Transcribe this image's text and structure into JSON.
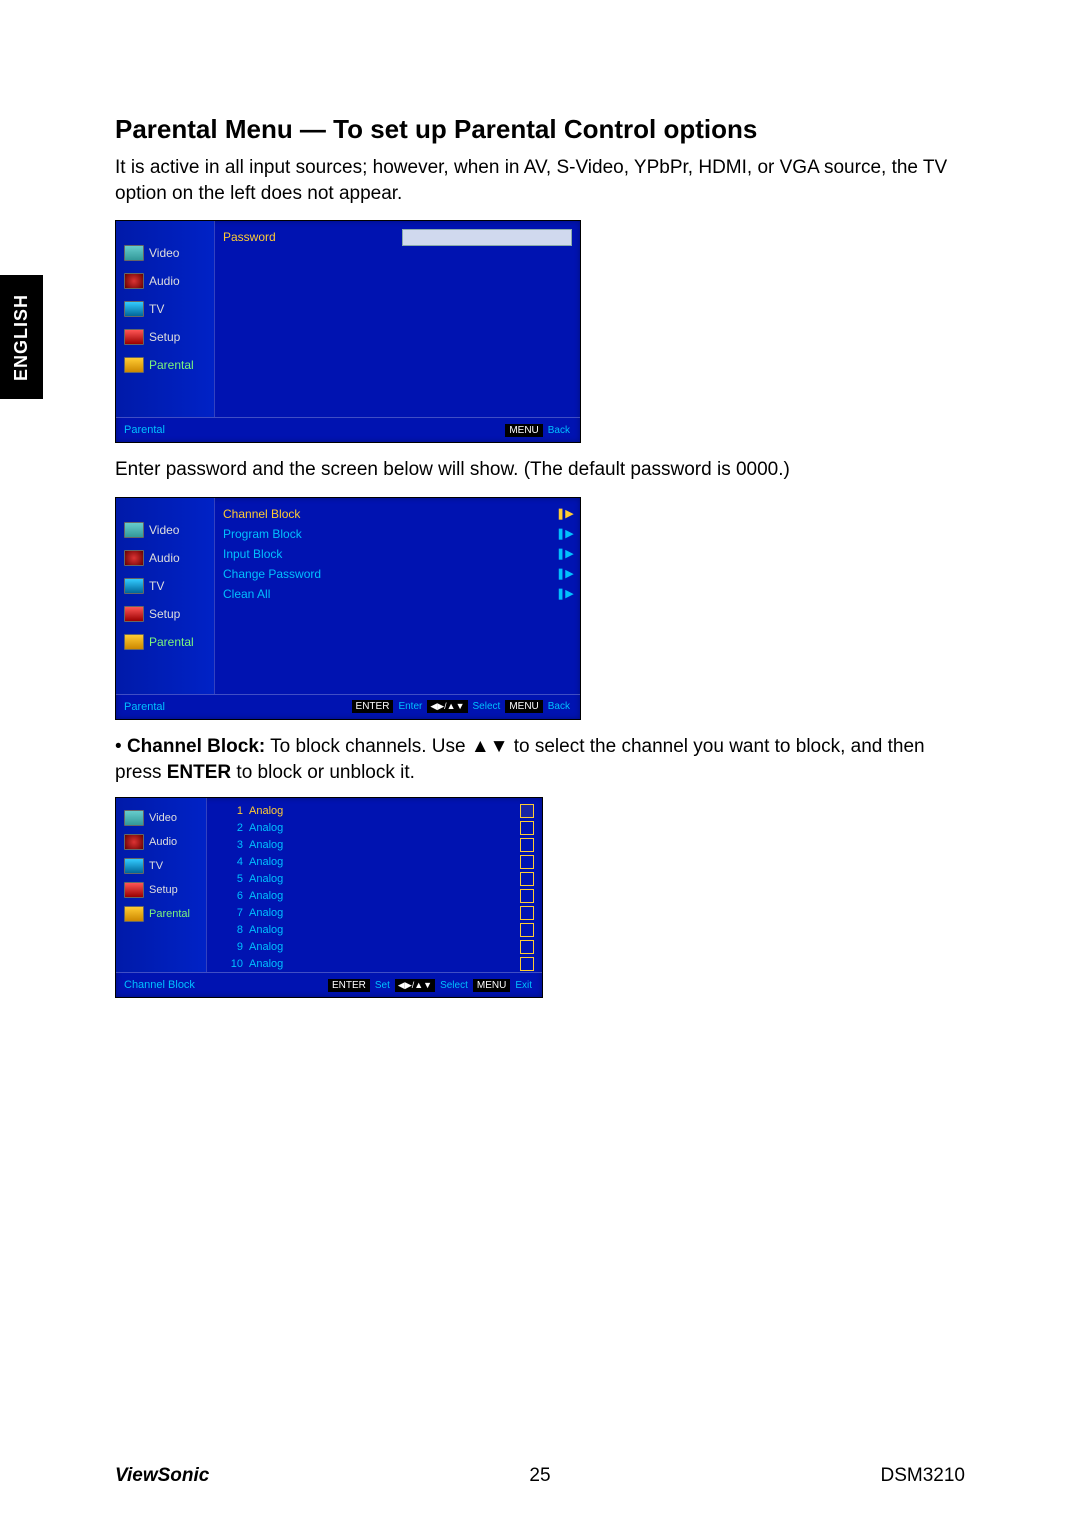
{
  "lang_tab": "ENGLISH",
  "heading": "Parental Menu — To set up Parental Control options",
  "intro": "It is active in all input sources; however, when in AV, S-Video, YPbPr, HDMI, or VGA source, the TV option on the left does not appear.",
  "sidebar": {
    "items": [
      {
        "label": "Video",
        "icon": "video"
      },
      {
        "label": "Audio",
        "icon": "audio"
      },
      {
        "label": "TV",
        "icon": "tv"
      },
      {
        "label": "Setup",
        "icon": "setup"
      },
      {
        "label": "Parental",
        "icon": "parental"
      }
    ]
  },
  "osd1": {
    "password_label": "Password",
    "footer_title": "Parental",
    "menu_key": "MENU",
    "menu_val": "Back"
  },
  "after_pw": "Enter password and the screen below will show. (The default password is 0000.)",
  "osd2": {
    "rows": [
      {
        "label": "Channel Block",
        "selected": true
      },
      {
        "label": "Program Block",
        "selected": false
      },
      {
        "label": "Input Block",
        "selected": false
      },
      {
        "label": "Change Password",
        "selected": false
      },
      {
        "label": "Clean All",
        "selected": false
      }
    ],
    "footer_title": "Parental",
    "enter_key": "ENTER",
    "enter_val": "Enter",
    "select_val": "Select",
    "menu_key": "MENU",
    "menu_val": "Back"
  },
  "bullet": {
    "label": "Channel Block:",
    "text1": " To block channels. Use ▲▼ to select the channel you want to block, and then press ",
    "enter": "ENTER",
    "text2": " to block or unblock it."
  },
  "osd3": {
    "rows": [
      {
        "num": "1",
        "type": "Analog",
        "selected": true
      },
      {
        "num": "2",
        "type": "Analog",
        "selected": false
      },
      {
        "num": "3",
        "type": "Analog",
        "selected": false
      },
      {
        "num": "4",
        "type": "Analog",
        "selected": false
      },
      {
        "num": "5",
        "type": "Analog",
        "selected": false
      },
      {
        "num": "6",
        "type": "Analog",
        "selected": false
      },
      {
        "num": "7",
        "type": "Analog",
        "selected": false
      },
      {
        "num": "8",
        "type": "Analog",
        "selected": false
      },
      {
        "num": "9",
        "type": "Analog",
        "selected": false
      },
      {
        "num": "10",
        "type": "Analog",
        "selected": false
      }
    ],
    "footer_title": "Channel Block",
    "enter_key": "ENTER",
    "enter_val": "Set",
    "select_val": "Select",
    "menu_key": "MENU",
    "menu_val": "Exit"
  },
  "footer": {
    "brand": "ViewSonic",
    "page": "25",
    "model": "DSM3210"
  }
}
